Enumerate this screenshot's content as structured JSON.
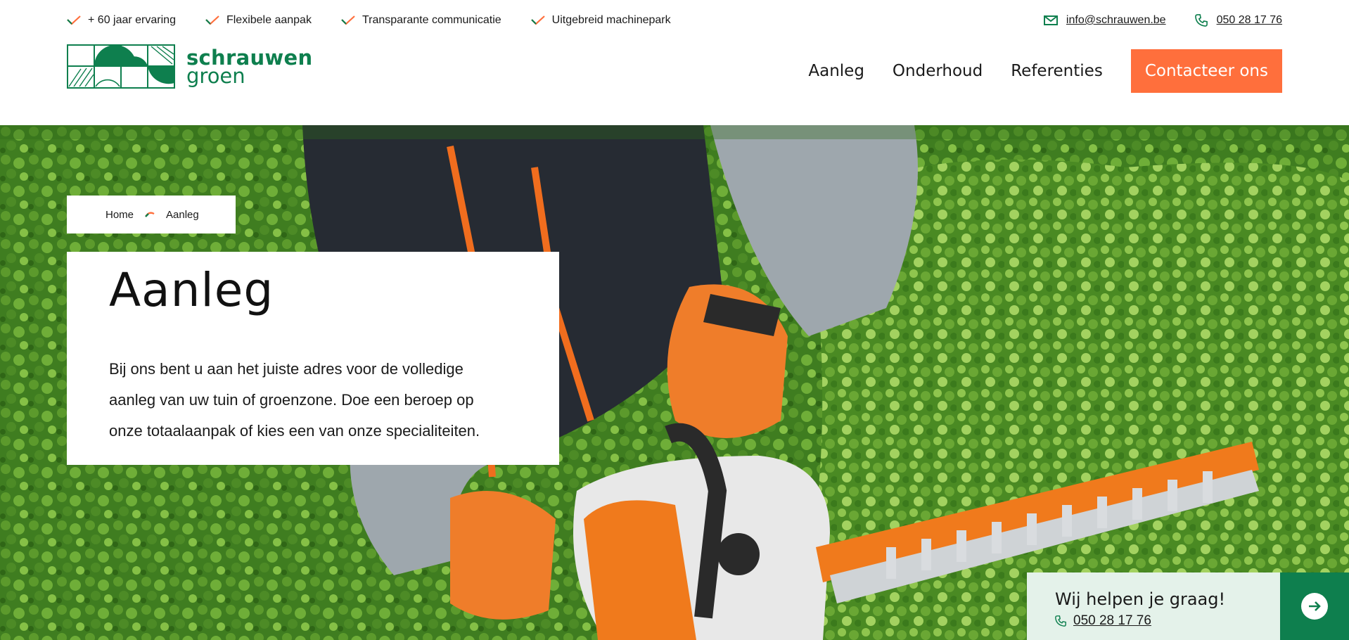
{
  "topbar": {
    "usps": [
      {
        "label": "+ 60 jaar ervaring",
        "icon": "check-icon"
      },
      {
        "label": "Flexibele aanpak",
        "icon": "check-icon"
      },
      {
        "label": "Transparante communicatie",
        "icon": "check-icon"
      },
      {
        "label": "Uitgebreid machinepark",
        "icon": "check-icon"
      }
    ],
    "email": "info@schrauwen.be",
    "phone": "050 28 17 76"
  },
  "logo": {
    "line1": "schrauwen",
    "line2": "groen"
  },
  "nav": {
    "items": [
      "Aanleg",
      "Onderhoud",
      "Referenties"
    ],
    "cta": "Contacteer ons"
  },
  "breadcrumb": {
    "home": "Home",
    "current": "Aanleg"
  },
  "hero": {
    "title": "Aanleg",
    "text": "Bij ons bent u aan het juiste adres voor de volledige aanleg van uw tuin of groenzone. Doe een beroep op onze totaalaanpak of kies een van onze specialiteiten."
  },
  "help": {
    "title": "Wij helpen je graag!",
    "phone": "050 28 17 76"
  },
  "colors": {
    "brand_green": "#0e7f4e",
    "accent_orange": "#ff6f3c",
    "help_bg": "#e4f2ea"
  }
}
